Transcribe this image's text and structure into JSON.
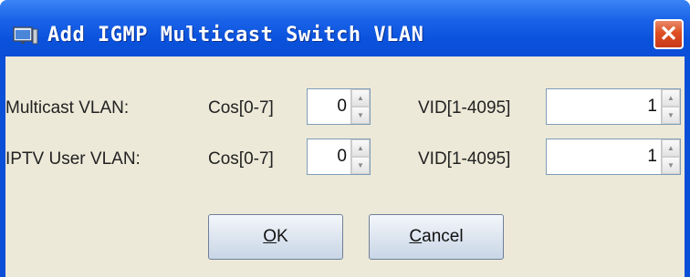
{
  "dialog": {
    "title": "Add IGMP Multicast Switch VLAN",
    "close_glyph": "✕"
  },
  "rows": [
    {
      "label": "Multicast VLAN:",
      "cos_label": "Cos[0-7]",
      "cos_value": "0",
      "vid_label": "VID[1-4095]",
      "vid_value": "1"
    },
    {
      "label": "IPTV User VLAN:",
      "cos_label": "Cos[0-7]",
      "cos_value": "0",
      "vid_label": "VID[1-4095]",
      "vid_value": "1"
    }
  ],
  "buttons": {
    "ok": {
      "mnemonic": "O",
      "rest": "K"
    },
    "cancel": {
      "mnemonic": "C",
      "rest": "ancel"
    }
  },
  "icons": {
    "title": "window-app-icon",
    "spin_up": "arrow-up-icon",
    "spin_down": "arrow-down-icon"
  },
  "colors": {
    "title_bar": "#0a52dc",
    "close_button": "#dd4f22",
    "body_background": "#ece9d8",
    "field_border": "#7f9db9"
  }
}
